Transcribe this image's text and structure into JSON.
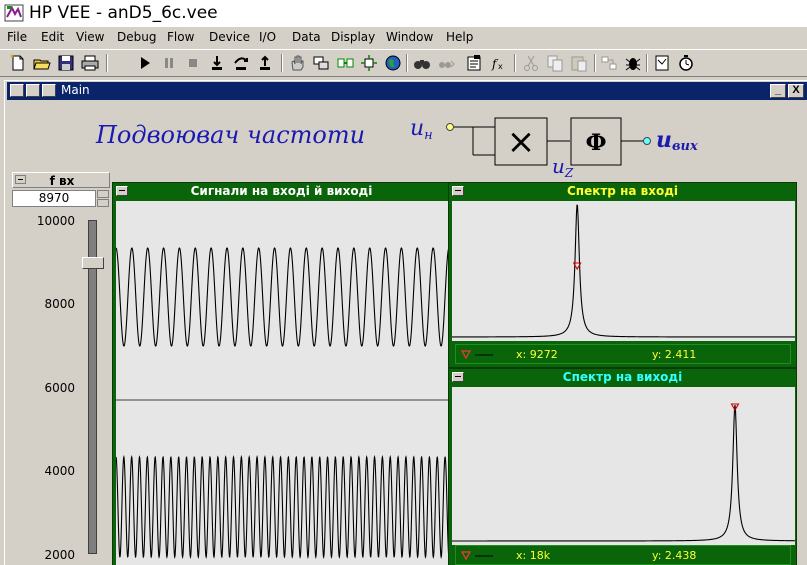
{
  "app": {
    "title": "HP VEE - anD5_6c.vee"
  },
  "menu": {
    "items": [
      "File",
      "Edit",
      "View",
      "Debug",
      "Flow",
      "Device",
      "I/O",
      "Data",
      "Display",
      "Window",
      "Help"
    ]
  },
  "toolbar": {
    "icons": [
      "new-icon",
      "open-icon",
      "save-icon",
      "print-icon",
      "run-icon",
      "pause-icon",
      "stop-icon",
      "step-into-icon",
      "step-over-icon",
      "step-out-icon",
      "hand-icon",
      "cut-object-icon",
      "connect-icon",
      "probe-icon",
      "globe-icon",
      "find-icon",
      "find-next-icon",
      "properties-icon",
      "function-icon",
      "cut-icon",
      "copy-icon",
      "paste-icon",
      "align-icon",
      "debug-icon",
      "notepad-icon",
      "timer-icon"
    ]
  },
  "main_window": {
    "title": "Main",
    "minimize_label": "_",
    "close_label": "X"
  },
  "heading": "Подвоювач частоти",
  "diagram": {
    "input_label": "u",
    "input_sub": "н",
    "multiplier_symbol": "×",
    "middle_label": "u",
    "middle_sub": "Z",
    "filter_symbol": "Ф",
    "output_label": "u",
    "output_sub": "вих"
  },
  "slider": {
    "title": "f вх",
    "value": "8970",
    "min": 2000,
    "max": 10000,
    "level": 8970,
    "tick_labels": [
      "10000",
      "8000",
      "6000",
      "4000",
      "2000"
    ]
  },
  "signal_panel": {
    "title": "Сигнали на вході й виході",
    "title_color": "#ffffff"
  },
  "spectrum_in": {
    "title": "Спектр на вході",
    "title_color": "#ffff33",
    "marker_x": "x: 9272",
    "marker_y": "y: 2.411"
  },
  "spectrum_out": {
    "title": "Спектр на виході",
    "title_color": "#33ffff",
    "marker_x": "x: 18k",
    "marker_y": "y: 2.438"
  },
  "colors": {
    "panel_green": "#0a640a",
    "heading_blue": "#1a1ab0",
    "marker_red": "#cc0000"
  }
}
